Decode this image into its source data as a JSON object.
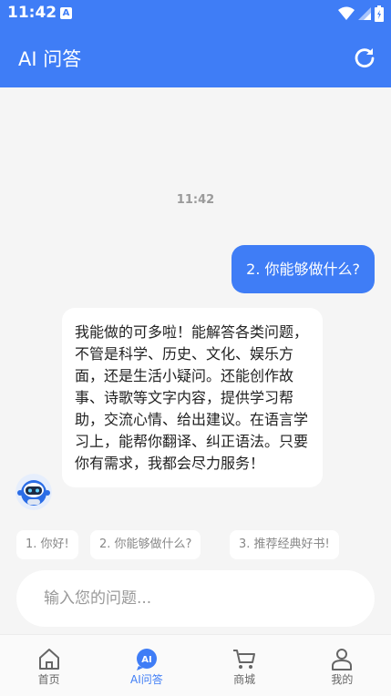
{
  "status_bar": {
    "time": "11:42",
    "notification_badge": "A"
  },
  "header": {
    "title": "AI 问答",
    "refresh_icon": "refresh-icon"
  },
  "chat": {
    "timestamp": "11:42",
    "messages": [
      {
        "role": "user",
        "text": "2. 你能够做什么?"
      },
      {
        "role": "bot",
        "text": "我能做的可多啦！能解答各类问题，不管是科学、历史、文化、娱乐方面，还是生活小疑问。还能创作故事、诗歌等文字内容，提供学习帮助，交流心情、给出建议。在语言学习上，能帮你翻译、纠正语法。只要你有需求，我都会尽力服务！"
      }
    ]
  },
  "suggestions": [
    "1. 你好!",
    "2. 你能够做什么?",
    "3. 推荐经典好书!"
  ],
  "input": {
    "placeholder": "输入您的问题..."
  },
  "tabs": [
    {
      "label": "首页",
      "icon": "home-icon",
      "active": false
    },
    {
      "label": "AI问答",
      "icon": "ai-icon",
      "active": true
    },
    {
      "label": "商城",
      "icon": "cart-icon",
      "active": false
    },
    {
      "label": "我的",
      "icon": "user-icon",
      "active": false
    }
  ],
  "colors": {
    "primary": "#3f7df6",
    "background": "#f5f5f5"
  }
}
